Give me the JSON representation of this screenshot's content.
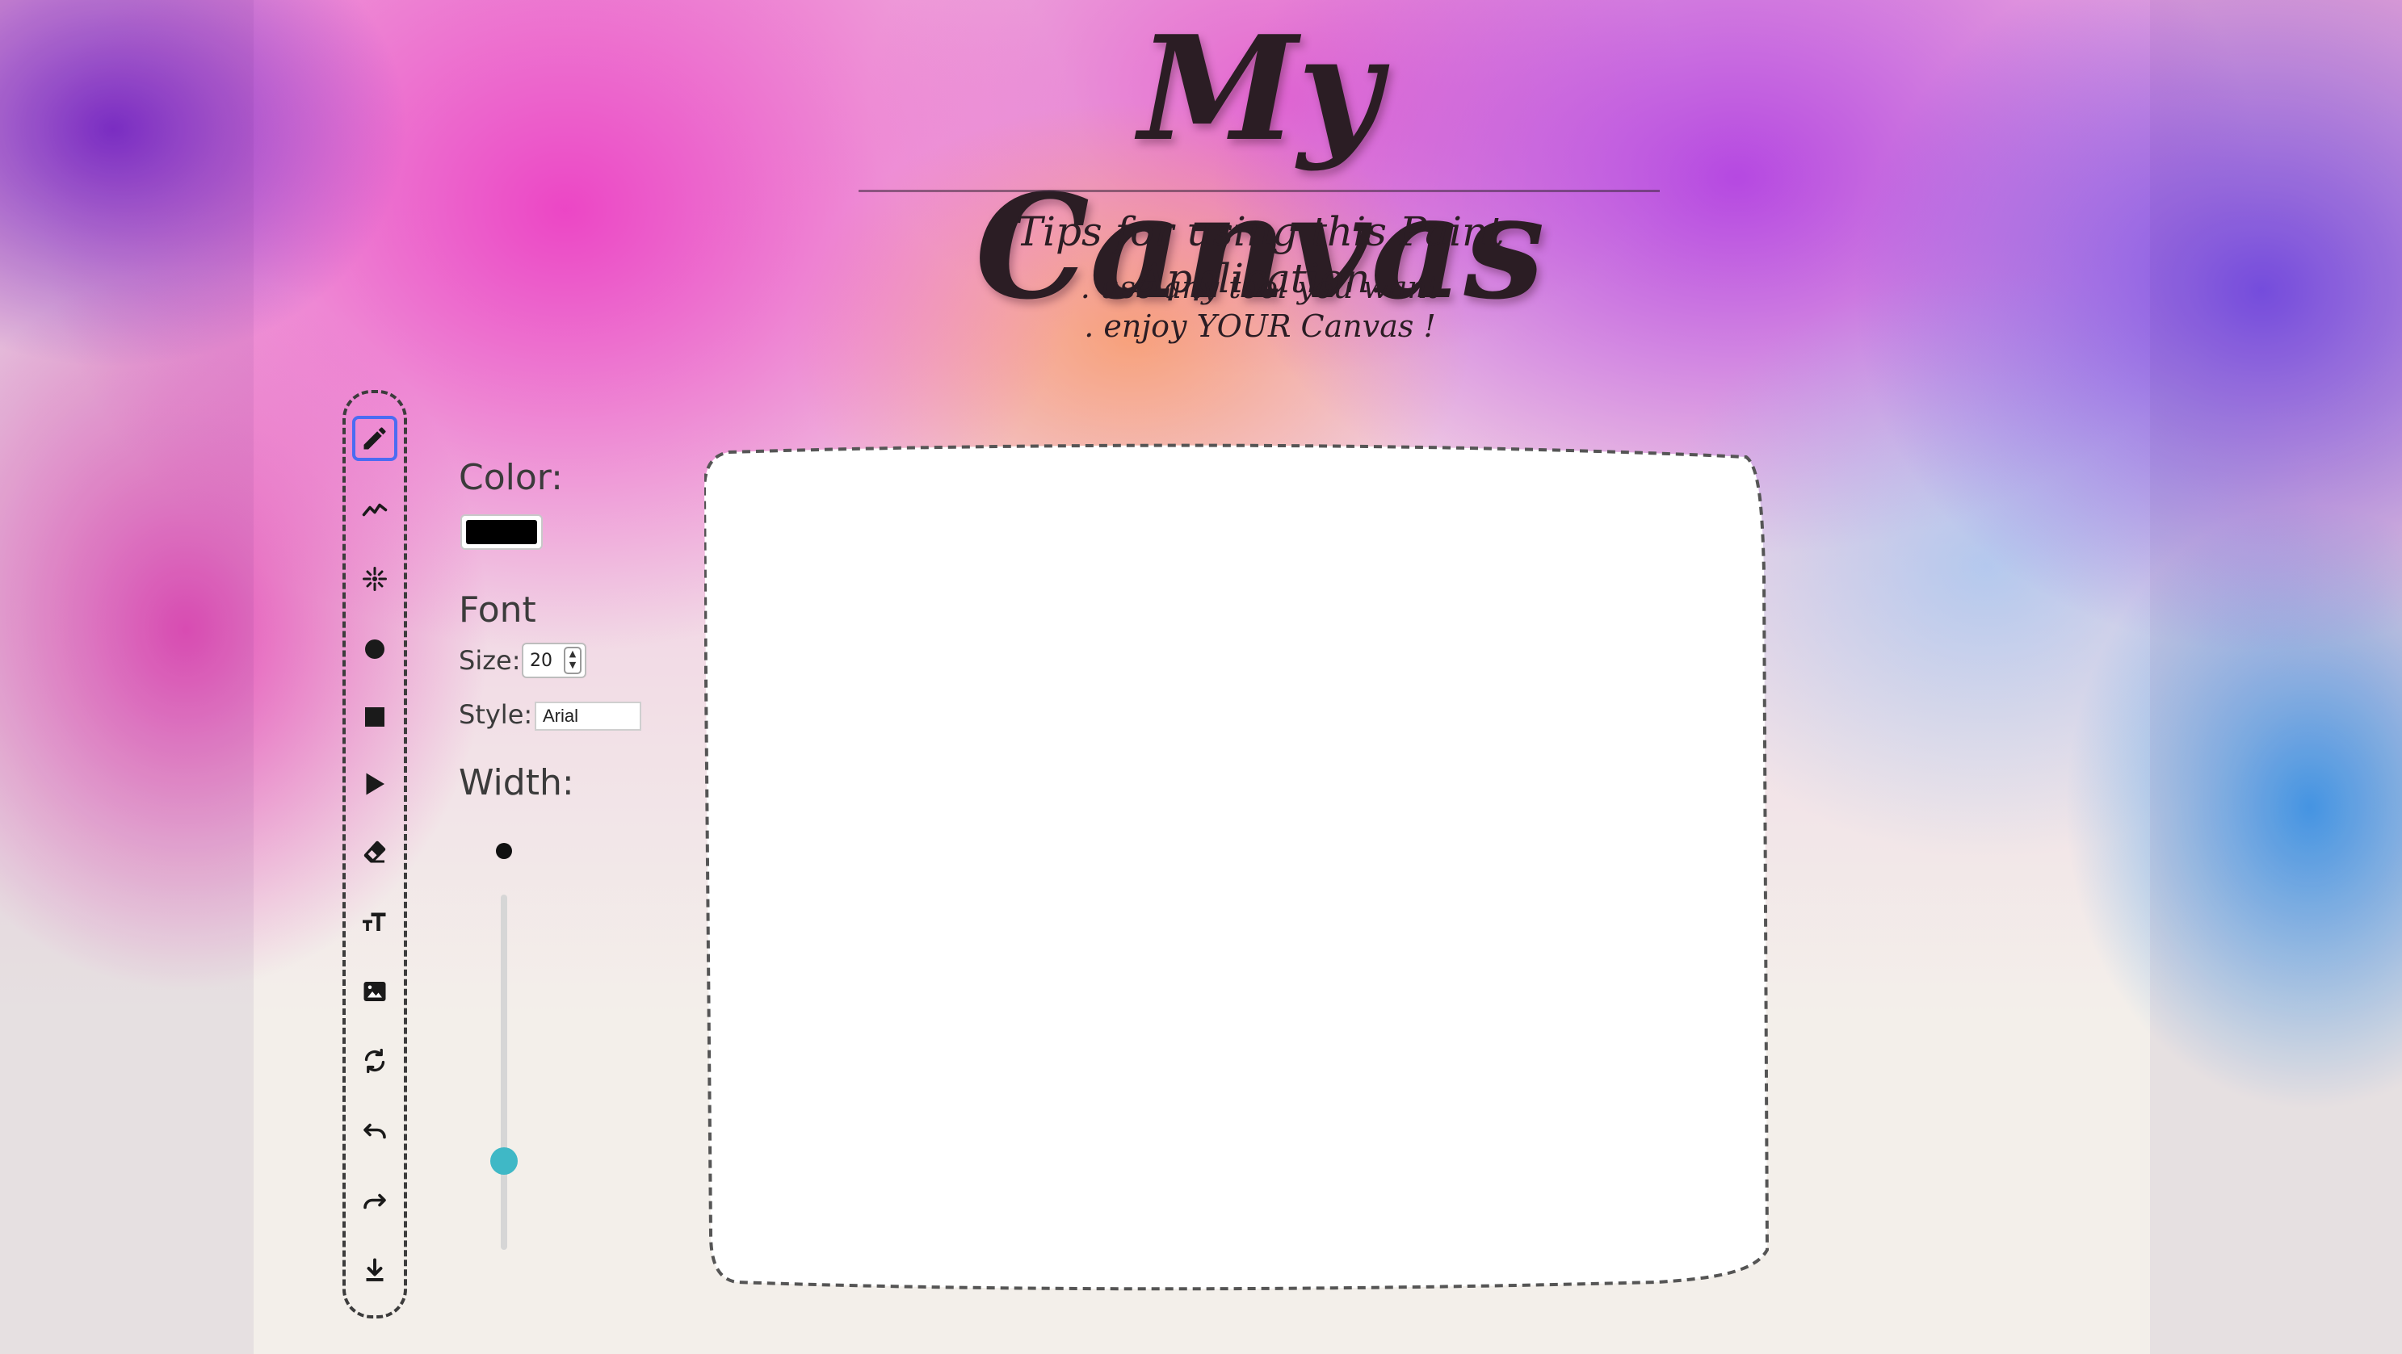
{
  "header": {
    "title": "My Canvas",
    "tips_heading": "Tips for using this Paint Application.",
    "tips": [
      ". use any tool you want",
      ". enjoy YOUR Canvas !"
    ]
  },
  "toolbar": {
    "active_tool": "pencil",
    "tools": [
      {
        "id": "pencil",
        "icon": "pencil-icon"
      },
      {
        "id": "line",
        "icon": "line-chart-icon"
      },
      {
        "id": "spray",
        "icon": "spray-icon"
      },
      {
        "id": "circle",
        "icon": "circle-icon"
      },
      {
        "id": "rectangle",
        "icon": "square-icon"
      },
      {
        "id": "triangle",
        "icon": "triangle-icon"
      },
      {
        "id": "eraser",
        "icon": "eraser-icon"
      },
      {
        "id": "text",
        "icon": "text-size-icon"
      },
      {
        "id": "image",
        "icon": "image-icon"
      },
      {
        "id": "refresh",
        "icon": "refresh-icon"
      },
      {
        "id": "undo",
        "icon": "undo-icon"
      },
      {
        "id": "redo",
        "icon": "redo-icon"
      },
      {
        "id": "download",
        "icon": "download-icon"
      }
    ]
  },
  "options": {
    "color_label": "Color:",
    "color_value": "#000000",
    "font_label": "Font",
    "size_label": "Size:",
    "size_value": "20",
    "style_label": "Style:",
    "style_value": "Arial",
    "width_label": "Width:",
    "width_level": 0.25
  },
  "colors": {
    "active_tool_border": "#4b6cf2",
    "slider_thumb": "#3fb8c6",
    "canvas": "#ffffff"
  }
}
